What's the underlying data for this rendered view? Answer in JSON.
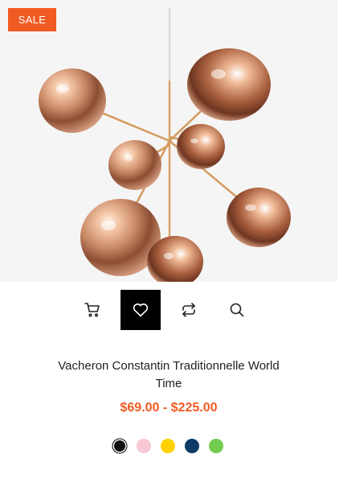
{
  "badge": {
    "label": "SALE"
  },
  "product": {
    "title": "Vacheron Constantin Traditionnelle World Time",
    "price": "$69.00 - $225.00"
  },
  "actions": [
    {
      "icon": "cart-icon"
    },
    {
      "icon": "heart-icon",
      "active": true
    },
    {
      "icon": "compare-icon"
    },
    {
      "icon": "search-icon"
    }
  ],
  "swatches": [
    {
      "color": "#111111",
      "selected": true
    },
    {
      "color": "#f8c9d4"
    },
    {
      "color": "#ffd200"
    },
    {
      "color": "#0d3b66"
    },
    {
      "color": "#72cc50"
    }
  ],
  "colors": {
    "accent": "#f15a22"
  }
}
